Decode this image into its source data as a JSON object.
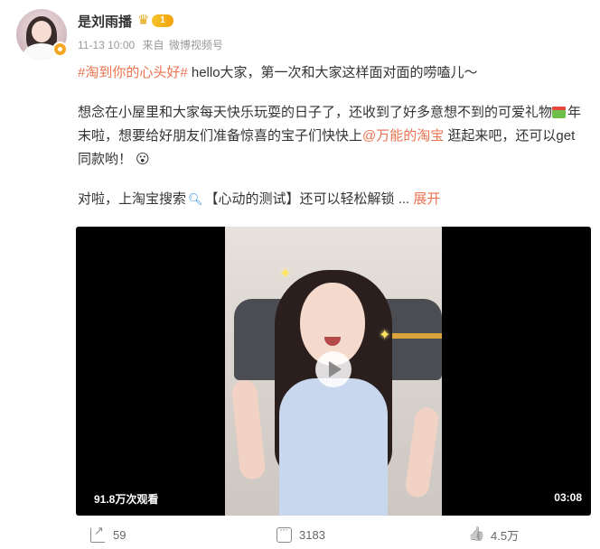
{
  "author": {
    "name": "是刘雨播",
    "level_badge": "1",
    "timestamp": "11-13 10:00",
    "source_prefix": "来自",
    "source": "微博视频号"
  },
  "post": {
    "topic_tag": "#淘到你的心头好#",
    "line1_rest": " hello大家，第一次和大家这样面对面的唠嗑儿～",
    "para2_part1": "想念在小屋里和大家每天快乐玩耍的日子了，还收到了好多意想不到的可爱礼物",
    "para2_part2": "年末啦，想要给好朋友们准备惊喜的宝子们快快上",
    "mention": "@万能的淘宝",
    "para2_part3": " 逛起来吧，还可以get同款哟！",
    "para3_part1": "对啦，上淘宝搜索",
    "para3_part2": "【心动的测试】还可以轻松解锁 ... ",
    "expand_label": "展开"
  },
  "video": {
    "view_count": "91.8万次观看",
    "duration": "03:08"
  },
  "actions": {
    "share_count": "59",
    "comment_count": "3183",
    "like_count": "4.5万"
  },
  "icons": {
    "share": "share-icon",
    "comment": "comment-icon",
    "like": "thumbs-up-icon",
    "gift": "gift-icon",
    "search": "magnifier-icon",
    "play": "play-icon"
  },
  "colors": {
    "link": "#eb7350",
    "level_badge": "#f2a10c",
    "verified": "#f5a623"
  }
}
